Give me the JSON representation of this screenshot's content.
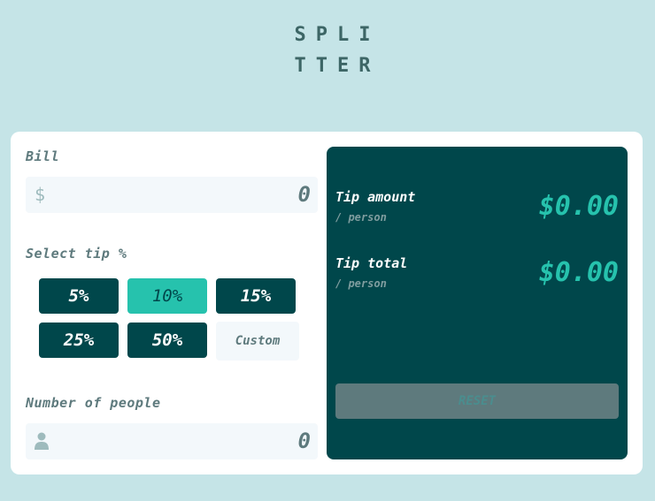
{
  "logo": {
    "line1": "SPLI",
    "line2": "TTER"
  },
  "bill": {
    "label": "Bill",
    "currency_symbol": "$",
    "value": "0"
  },
  "tip": {
    "label": "Select tip %",
    "options": [
      "5%",
      "10%",
      "15%",
      "25%",
      "50%"
    ],
    "custom_placeholder": "Custom",
    "selected": "10%"
  },
  "people": {
    "label": "Number of people",
    "value": "0"
  },
  "results": {
    "tip_amount": {
      "title": "Tip amount",
      "sub": "/ person",
      "value": "$0.00"
    },
    "total": {
      "title": "Tip total",
      "sub": "/ person",
      "value": "$0.00"
    },
    "reset_label": "RESET"
  },
  "colors": {
    "background": "#c5e4e7",
    "dark_cyan": "#00474b",
    "strong_cyan": "#26c2ad",
    "grayish_cyan": "#5e7a7d",
    "input_bg": "#f3f8fb"
  },
  "icons": {
    "person": "person-icon",
    "dollar": "dollar-icon"
  }
}
